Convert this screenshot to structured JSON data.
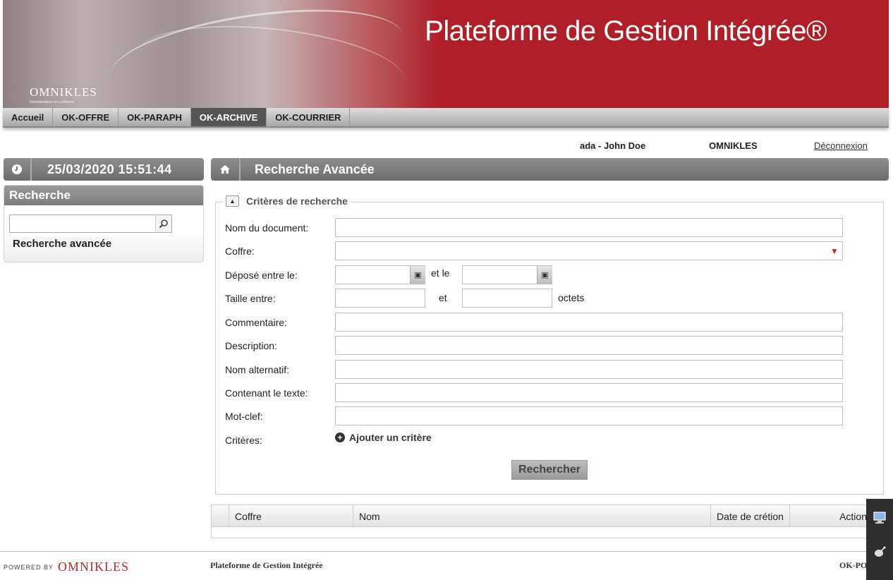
{
  "banner": {
    "title": "Plateforme de Gestion Intégrée®",
    "logo": "OMNIKLES",
    "logo_tag": "Dématérialisez en confiance"
  },
  "nav": {
    "tabs": [
      "Accueil",
      "OK-OFFRE",
      "OK-PARAPH",
      "OK-ARCHIVE",
      "OK-COURRIER"
    ],
    "active": "OK-ARCHIVE"
  },
  "user": {
    "name": "ada - John Doe",
    "org": "OMNIKLES",
    "logout": "Déconnexion"
  },
  "left": {
    "datetime": "25/03/2020 15:51:44",
    "search_title": "Recherche",
    "search_value": "",
    "advanced_link": "Recherche avancée"
  },
  "main": {
    "breadcrumb": "Recherche Avancée",
    "criteria_legend": "Critères de recherche",
    "fields": {
      "doc_name": "Nom du document:",
      "coffre": "Coffre:",
      "depose": "Déposé entre le:",
      "depose_and": "et le",
      "taille": "Taille entre:",
      "taille_and": "et",
      "taille_unit": "octets",
      "commentaire": "Commentaire:",
      "description": "Description:",
      "nom_alt": "Nom alternatif:",
      "contenant": "Contenant le texte:",
      "motclef": "Mot-clef:",
      "criteres": "Critères:"
    },
    "add_criterion": "Ajouter un critère",
    "search_button": "Rechercher",
    "table_headers": [
      "Coffre",
      "Nom",
      "Date de crétion",
      "Actions"
    ]
  },
  "footer": {
    "powered_by": "POWERED BY",
    "powered_logo": "OMNIKLES",
    "title": "Plateforme de Gestion Intégrée",
    "right": "OK-PO"
  },
  "colors": {
    "brand_red": "#b01e27",
    "nav_active": "#555555"
  },
  "icons": [
    "clock-icon",
    "search-icon",
    "home-icon",
    "collapse-icon",
    "calendar-icon",
    "chevron-down-icon",
    "plus-icon",
    "monitor-icon",
    "satellite-icon"
  ]
}
